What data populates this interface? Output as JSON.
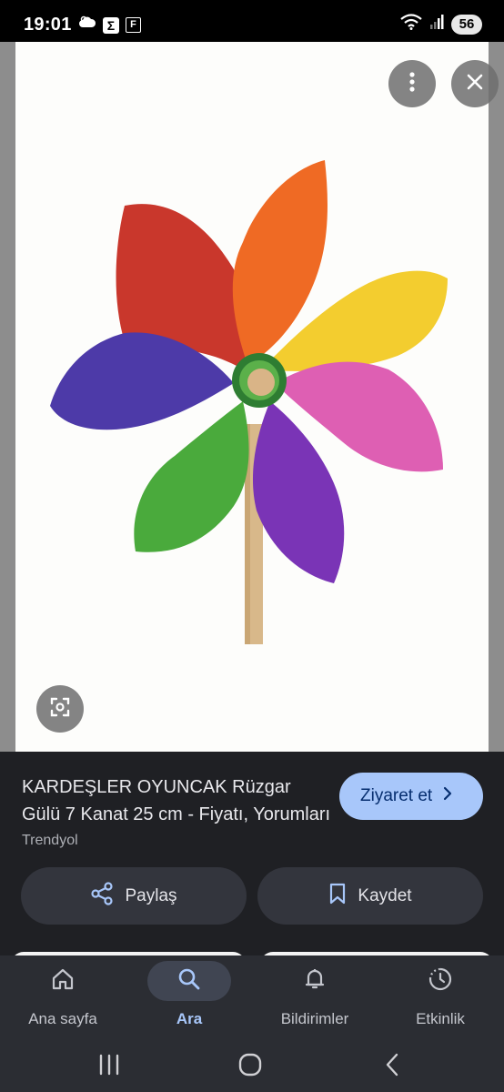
{
  "status_bar": {
    "time": "19:01",
    "left_icons": [
      "cloud-icon",
      "sigma-icon",
      "f-icon"
    ],
    "sigma_glyph": "Σ",
    "f_glyph": "F",
    "right_icons": [
      "wifi-icon",
      "signal-icon"
    ],
    "battery": "56"
  },
  "viewer": {
    "image_subject": "pinwheel",
    "more_icon": "more-vert-icon",
    "close_icon": "close-icon",
    "lens_icon": "lens-icon"
  },
  "result": {
    "title": "KARDEŞLER OYUNCAK Rüzgar Gülü 7 Kanat 25 cm - Fiyatı, Yorumları",
    "source": "Trendyol",
    "visit_label": "Ziyaret et",
    "share_label": "Paylaş",
    "save_label": "Kaydet"
  },
  "bottom_nav": {
    "items": [
      {
        "label": "Ana sayfa",
        "icon": "home-icon",
        "active": false
      },
      {
        "label": "Ara",
        "icon": "search-icon",
        "active": true
      },
      {
        "label": "Bildirimler",
        "icon": "bell-icon",
        "active": false
      },
      {
        "label": "Etkinlik",
        "icon": "activity-icon",
        "active": false
      }
    ]
  },
  "colors": {
    "accent": "#a8c7fa",
    "panel_bg": "#1f2024",
    "nav_bg": "#2b2d33"
  }
}
